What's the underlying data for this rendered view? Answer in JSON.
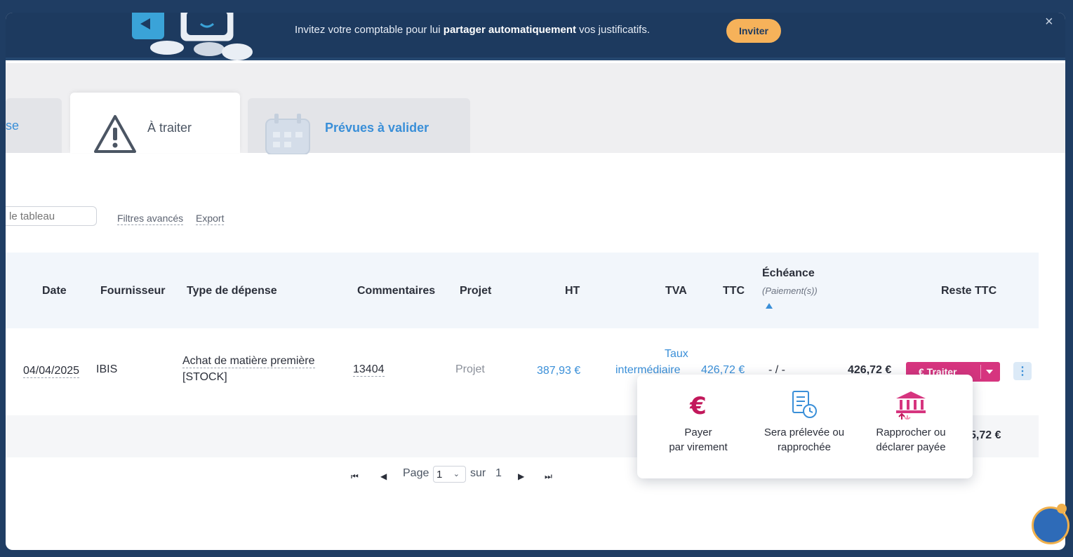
{
  "banner": {
    "text_before": "Invitez votre comptable pour lui ",
    "text_bold": "partager automatiquement",
    "text_after": " vos justificatifs.",
    "invite_label": "Inviter",
    "close_label": "×"
  },
  "tabs": {
    "left_partial": "se",
    "active": "À traiter",
    "prevues": "Prévues à valider"
  },
  "toolbar": {
    "search_placeholder": "le tableau",
    "filters_label": "Filtres avancés",
    "export_label": "Export"
  },
  "table": {
    "headers": {
      "date": "Date",
      "fournisseur": "Fournisseur",
      "type": "Type de dépense",
      "commentaires": "Commentaires",
      "projet": "Projet",
      "ht": "HT",
      "tva": "TVA",
      "ttc": "TTC",
      "echeance": "Échéance",
      "echeance_sub": "(Paiement(s))",
      "reste": "Reste TTC"
    },
    "row": {
      "date": "04/04/2025",
      "fournisseur": "IBIS",
      "type_line1": "Achat de matière première",
      "type_line2": "[STOCK]",
      "commentaires": "13404",
      "projet": "Projet",
      "ht": "387,93 €",
      "tva_line1": "Taux",
      "tva_line2": "intermédiaire",
      "ttc": "426,72 €",
      "echeance": "- / -",
      "reste": "426,72 €",
      "action_label": "€ Traiter"
    },
    "total_partial": "5,72 €"
  },
  "popover": {
    "item1_line1": "Payer",
    "item1_line2": "par virement",
    "item2_line1": "Sera prélevée ou",
    "item2_line2": "rapprochée",
    "item3_line1": "Rapprocher ou",
    "item3_line2": "déclarer payée"
  },
  "pagination": {
    "page_label": "Page",
    "current": "1",
    "sur_label": "sur",
    "total": "1"
  },
  "colors": {
    "banner": "#1d3a5f",
    "accent_blue": "#3a8fd8",
    "action_pink": "#d6357f",
    "invite_orange": "#f6b25a"
  }
}
